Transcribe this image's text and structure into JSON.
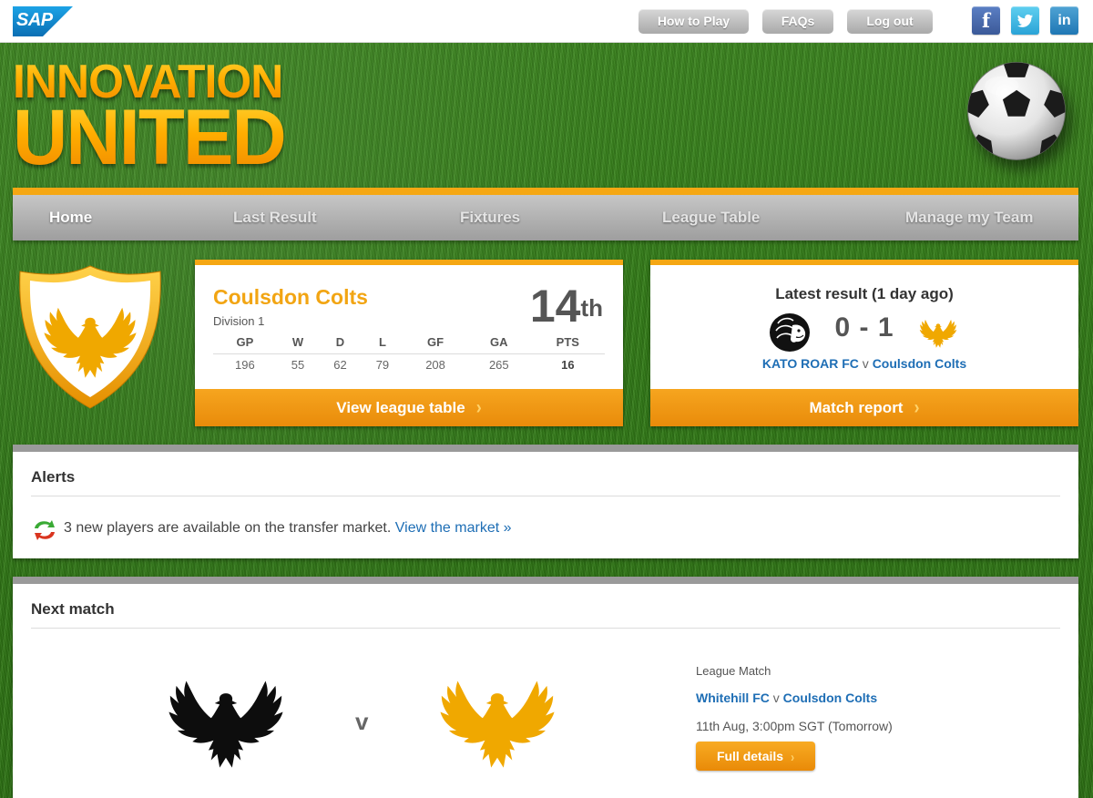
{
  "header": {
    "logo_text": "SAP",
    "buttons": [
      "How to Play",
      "FAQs",
      "Log out"
    ],
    "social": [
      "f",
      "t",
      "in"
    ]
  },
  "brand": {
    "line1": "INNOVATION",
    "line2": "UNITED"
  },
  "nav": {
    "items": [
      "Home",
      "Last Result",
      "Fixtures",
      "League Table",
      "Manage my Team"
    ],
    "active_index": 0
  },
  "team_card": {
    "name": "Coulsdon Colts",
    "division": "Division 1",
    "position_number": "14",
    "position_suffix": "th",
    "stats_headers": [
      "GP",
      "W",
      "D",
      "L",
      "GF",
      "GA",
      "PTS"
    ],
    "stats_values": [
      "196",
      "55",
      "62",
      "79",
      "208",
      "265",
      "16"
    ],
    "footer_label": "View league table"
  },
  "latest_result": {
    "title": "Latest result (1 day ago)",
    "score": "0 - 1",
    "home_team": "KATO ROAR FC",
    "separator": "v",
    "away_team": "Coulsdon Colts",
    "footer_label": "Match report"
  },
  "alerts": {
    "title": "Alerts",
    "message": "3 new players are available on the transfer market.",
    "link_label": "View the market »"
  },
  "next_match": {
    "title": "Next match",
    "vs_label": "v",
    "match_type": "League Match",
    "home_team": "Whitehill FC",
    "separator": "v",
    "away_team": "Coulsdon Colts",
    "datetime": "11th Aug, 3:00pm SGT (Tomorrow)",
    "details_label": "Full details"
  },
  "colors": {
    "accent_orange": "#f5a713",
    "link_blue": "#1e6eb5",
    "panel_grey": "#9a9a9a",
    "grass_green": "#358019"
  },
  "icons": {
    "facebook": "facebook-icon",
    "twitter": "twitter-icon",
    "linkedin": "linkedin-icon",
    "transfer": "transfer-arrows-icon",
    "crest": "eagle-crest-icon",
    "ball": "soccer-ball-icon",
    "lion": "lion-badge-icon"
  }
}
